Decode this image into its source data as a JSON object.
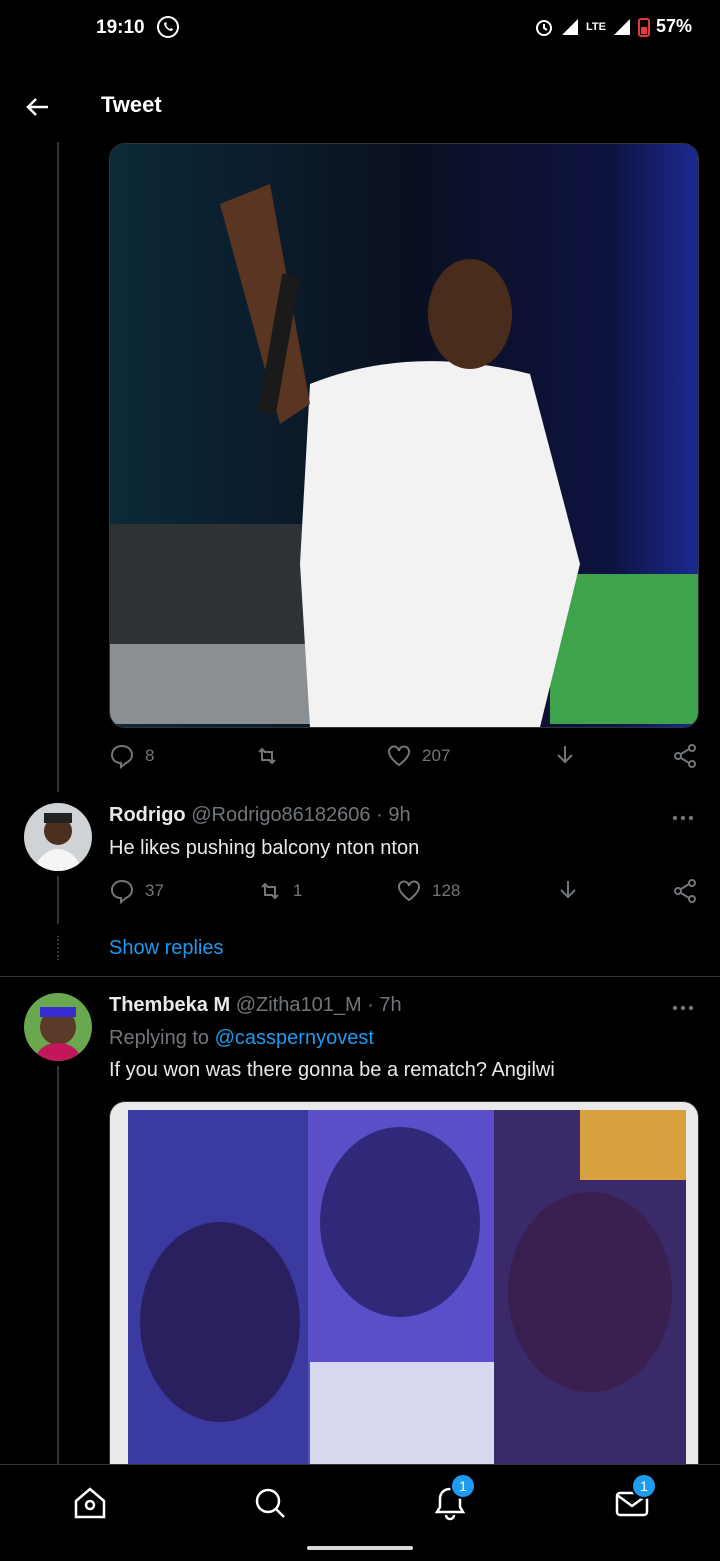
{
  "status_bar": {
    "time": "19:10",
    "network": "LTE",
    "battery": "57%"
  },
  "header": {
    "title": "Tweet"
  },
  "main_tweet": {
    "replies": "8",
    "likes": "207"
  },
  "reply1": {
    "name": "Rodrigo",
    "handle": "@Rodrigo86182606 · 9h",
    "text": "He likes pushing balcony nton nton",
    "replies": "37",
    "retweets": "1",
    "likes": "128",
    "show_replies": "Show replies"
  },
  "reply2": {
    "name": "Thembeka M",
    "handle": "@Zitha101_M · 7h",
    "replying_label": "Replying to",
    "replying_handle": "@casspernyovest",
    "text": "If you won was there gonna be a rematch? Angilwi"
  },
  "bottom_nav": {
    "notifications_badge": "1",
    "messages_badge": "1"
  },
  "colors": {
    "accent": "#1d9bf0",
    "muted": "#71767b",
    "background": "#000000"
  }
}
